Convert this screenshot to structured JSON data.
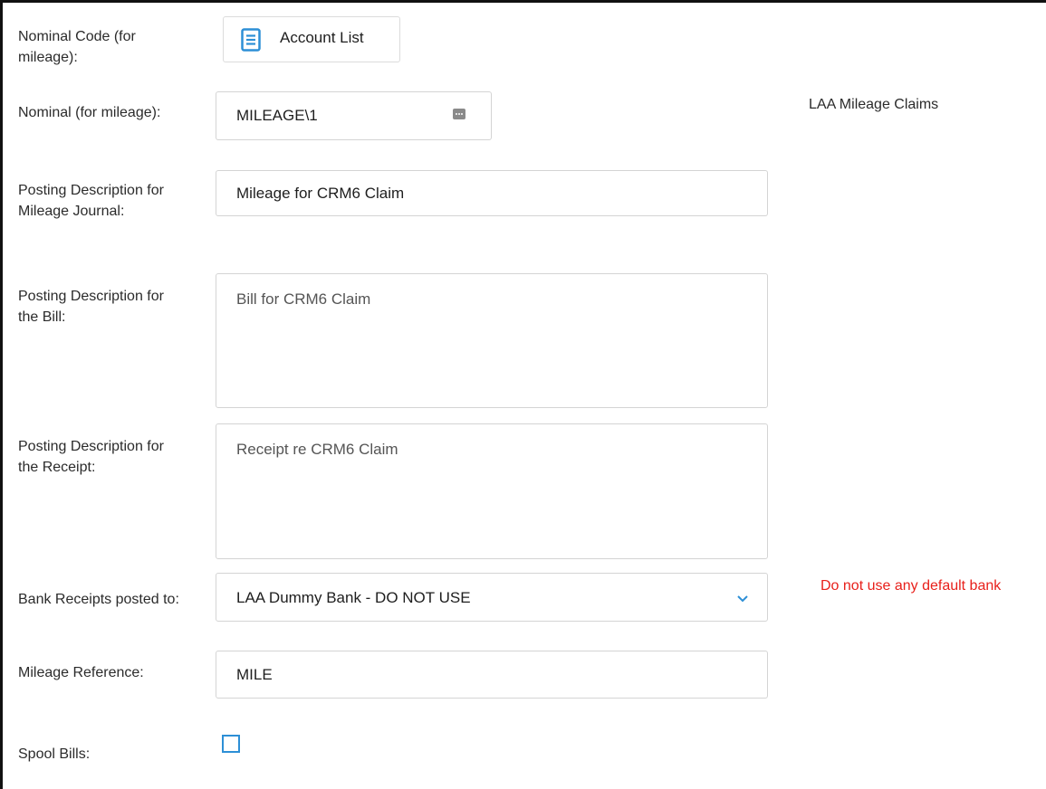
{
  "fields": {
    "nominal_code": {
      "label": "Nominal Code (for mileage):",
      "button_label": "Account List"
    },
    "nominal": {
      "label": "Nominal (for mileage):",
      "value": "MILEAGE\\1",
      "note": "LAA Mileage Claims"
    },
    "mileage_journal": {
      "label": "Posting Description for Mileage Journal:",
      "value": "Mileage for CRM6 Claim"
    },
    "bill_description": {
      "label": "Posting Description for the Bill:",
      "value": "Bill for CRM6 Claim"
    },
    "receipt_description": {
      "label": "Posting Description for the Receipt:",
      "value": "Receipt re CRM6 Claim"
    },
    "bank_receipts": {
      "label": "Bank Receipts posted to:",
      "selected": "LAA Dummy Bank - DO NOT USE",
      "warning": "Do not use any default bank"
    },
    "mileage_reference": {
      "label": "Mileage Reference:",
      "value": "MILE"
    },
    "spool_bills": {
      "label": "Spool Bills:",
      "checked": false
    }
  },
  "icons": {
    "account_list": "document-list-icon",
    "nominal_lookup": "lookup-dots-icon",
    "dropdown": "chevron-down-icon"
  },
  "colors": {
    "accent": "#2d8fd6",
    "warning": "#e8201b",
    "border": "#d4d4d4"
  }
}
